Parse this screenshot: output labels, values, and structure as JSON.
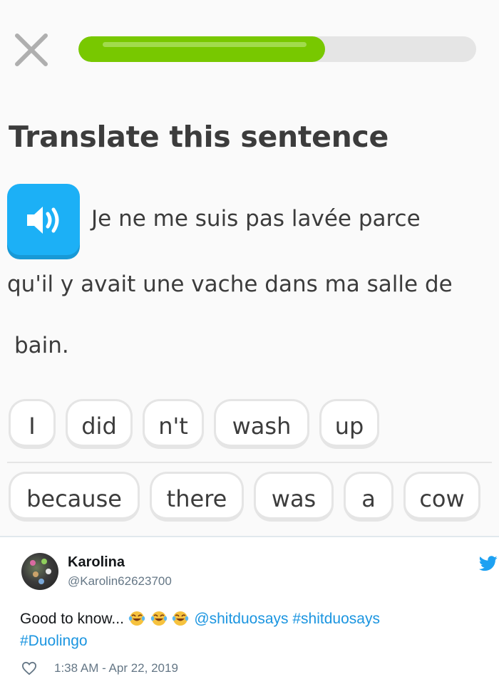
{
  "header": {
    "close_icon": "close-icon",
    "progress": 0.62,
    "progress_color": "#78c800",
    "track_color": "#e5e5e5"
  },
  "challenge": {
    "heading": "Translate this sentence",
    "speaker_icon": "speaker-icon",
    "speaker_color": "#1cb0f6",
    "sentence_lines": [
      "Je ne me suis pas lavée parce",
      "qu'il y avait une vache dans ma salle de",
      "bain."
    ]
  },
  "word_bank": {
    "row1": [
      "I",
      "did",
      "n't",
      "wash",
      "up"
    ],
    "row2": [
      "because",
      "there",
      "was",
      "a",
      "cow"
    ]
  },
  "tweet": {
    "author_name": "Karolina",
    "author_handle": "@Karolin62623700",
    "text_prefix": "Good to know...",
    "emoji_icon": "tears-of-joy-icon",
    "mention": "@shitduosays",
    "hashtag1": "#shitduosays",
    "hashtag2": "#Duolingo",
    "timestamp": "1:38 AM - Apr 22, 2019",
    "like_icon": "heart-icon",
    "platform_icon": "twitter-bird-icon",
    "link_color": "#1b95e0"
  }
}
